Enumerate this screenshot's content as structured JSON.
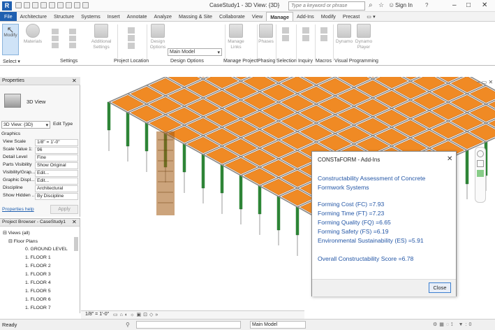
{
  "app": {
    "doc_title": "CaseStudy1 - 3D View: {3D}",
    "search_placeholder": "Type a keyword or phrase",
    "sign_in": "Sign In"
  },
  "tabs": [
    "File",
    "Architecture",
    "Structure",
    "Systems",
    "Insert",
    "Annotate",
    "Analyze",
    "Massing & Site",
    "Collaborate",
    "View",
    "Manage",
    "Add-Ins",
    "Modify",
    "Precast"
  ],
  "active_tab": "Manage",
  "ribbon": {
    "modify": "Modify",
    "materials": "Materials",
    "additional_settings": "Additional Settings",
    "design_options": "Design Options",
    "main_model": "Main Model",
    "manage_links": "Manage Links",
    "phases": "Phases",
    "dynamo": "Dynamo",
    "dynamo_player": "Dynamo Player",
    "groups": [
      "Select ▾",
      "Settings",
      "Project Location",
      "Design Options",
      "Manage Project",
      "Phasing",
      "Selection",
      "Inquiry",
      "Macros",
      "Visual Programming"
    ]
  },
  "properties": {
    "title": "Properties",
    "type_name": "3D View",
    "view_selector": "3D View: {3D}",
    "edit_type": "Edit Type",
    "section": "Graphics",
    "rows": [
      {
        "k": "View Scale",
        "v": "1/8\" = 1'-0\""
      },
      {
        "k": "Scale Value  1:",
        "v": "96"
      },
      {
        "k": "Detail Level",
        "v": "Fine"
      },
      {
        "k": "Parts Visibility",
        "v": "Show Original"
      },
      {
        "k": "Visibility/Grap...",
        "v": "Edit..."
      },
      {
        "k": "Graphic Displ...",
        "v": "Edit..."
      },
      {
        "k": "Discipline",
        "v": "Architectural"
      },
      {
        "k": "Show Hidden ...",
        "v": "By Discipline"
      }
    ],
    "help": "Properties help",
    "apply": "Apply"
  },
  "browser": {
    "title": "Project Browser - CaseStudy1",
    "root": "Views (all)",
    "group": "Floor Plans",
    "items": [
      "0. GROUND LEVEL",
      "1. FLOOR 1",
      "1. FLOOR 2",
      "1. FLOOR 3",
      "1. FLOOR 4",
      "1. FLOOR 5",
      "1. FLOOR 6",
      "1. FLOOR 7"
    ]
  },
  "dialog": {
    "title": "CONSTaFORM - Add-Ins",
    "heading": "Constructability Assessment of Concrete Formwork Systems",
    "metrics": [
      "Forming Cost (FC) =7.93",
      "Forming Time (FT) =7.23",
      "Forming Quality (FQ) =6.65",
      "Forming Safety (FS) =6.19",
      "Environmental Sustainability (ES) =5.91"
    ],
    "overall": "Overall Constructability Score =6.78",
    "close": "Close"
  },
  "viewbar": {
    "scale": "1/8\" = 1'-0\""
  },
  "status": {
    "left": "Ready",
    "model": "Main Model"
  },
  "colors": {
    "accent": "#1f5fb0",
    "deck": "#f08a24",
    "column": "#2f9a3a",
    "text_blue": "#2356a6"
  }
}
